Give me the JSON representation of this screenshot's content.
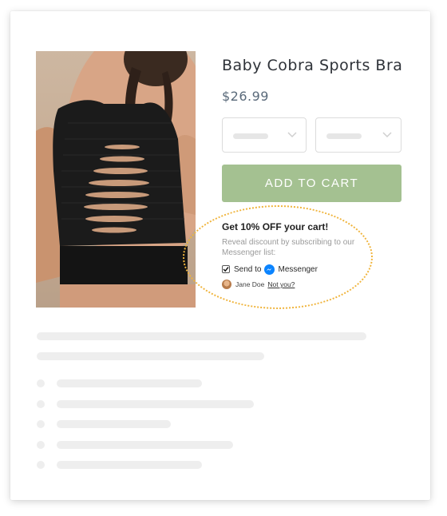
{
  "product": {
    "title": "Baby Cobra Sports Bra",
    "price": "$26.99",
    "add_to_cart_label": "ADD TO CART",
    "image_description": "product-photo"
  },
  "promo": {
    "headline": "Get 10% OFF your cart!",
    "subtext": "Reveal discount by subscribing to our Messenger list:",
    "send_to_label": "Send to",
    "messenger_label": "Messenger",
    "checkbox_checked": true,
    "user_name": "Jane Doe",
    "not_you_label": "Not you?"
  },
  "colors": {
    "add_to_cart_bg": "#a4c191",
    "promo_outline": "#f0b43c",
    "messenger_blue": "#0b84ff"
  },
  "placeholder_text_rows": 2,
  "placeholder_bullet_rows": 5
}
